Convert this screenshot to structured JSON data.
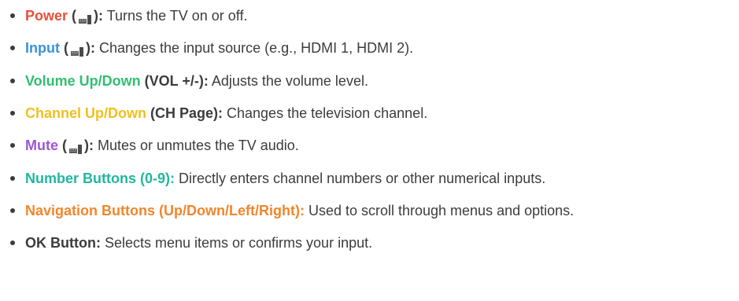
{
  "colors": {
    "text": "#3c3c3c",
    "power": "#e8503a",
    "input": "#3a93d8",
    "volume": "#2fbf71",
    "channel": "#f0c020",
    "mute": "#9b59d0",
    "number": "#22b6a0",
    "navigation": "#f0862c",
    "ok": "#3c3c3c"
  },
  "items": [
    {
      "name_parts": [
        "Power"
      ],
      "paren_open": " (",
      "paren_close": "):",
      "icon": "remote-button-icon",
      "desc": " Turns the TV on or off."
    },
    {
      "name_parts": [
        "Input"
      ],
      "paren_open": " (",
      "paren_close": "):",
      "icon": "remote-button-icon",
      "desc": " Changes the input source (e.g., HDMI 1, HDMI 2)."
    },
    {
      "name": "Volume Up/Down",
      "paren": " (VOL +/-):",
      "desc": " Adjusts the volume level."
    },
    {
      "name": "Channel Up/Down",
      "paren": " (CH Page):",
      "desc": " Changes the television channel."
    },
    {
      "name_parts": [
        "Mute"
      ],
      "paren_open": " (",
      "paren_close": "):",
      "icon": "remote-button-icon",
      "desc": " Mutes or unmutes the TV audio."
    },
    {
      "name": "Number Buttons (0-9):",
      "desc": " Directly enters channel numbers or other numerical inputs."
    },
    {
      "name": "Navigation Buttons (Up/Down/Left/Right):",
      "desc": " Used to scroll through menus and options."
    },
    {
      "name": "OK Button:",
      "desc": " Selects menu items or confirms your input."
    }
  ]
}
